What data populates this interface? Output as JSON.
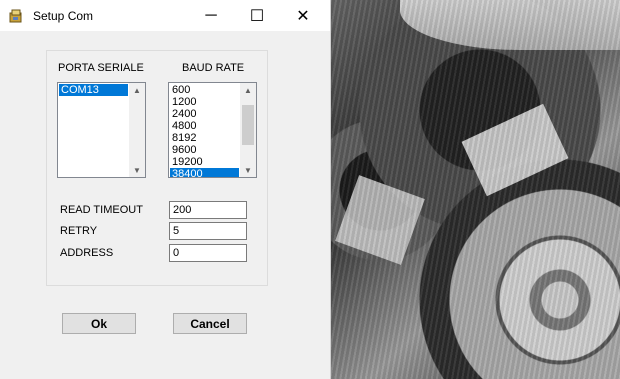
{
  "window": {
    "title": "Setup Com",
    "app_icon": "setup-app-icon",
    "controls": {
      "minimize": "─",
      "maximize": "☐",
      "close": "✕"
    }
  },
  "serial_port": {
    "label": "PORTA SERIALE",
    "items": [
      "COM13"
    ],
    "selected": "COM13"
  },
  "baud_rate": {
    "label": "BAUD RATE",
    "items": [
      "600",
      "1200",
      "2400",
      "4800",
      "8192",
      "9600",
      "19200",
      "38400"
    ],
    "selected": "38400"
  },
  "fields": {
    "read_timeout": {
      "label": "READ TIMEOUT",
      "value": "200"
    },
    "retry": {
      "label": "RETRY",
      "value": "5"
    },
    "address": {
      "label": "ADDRESS",
      "value": "0"
    }
  },
  "buttons": {
    "ok": "Ok",
    "cancel": "Cancel"
  },
  "colors": {
    "selection": "#0078d7",
    "dialog_bg": "#f0f0f0"
  }
}
